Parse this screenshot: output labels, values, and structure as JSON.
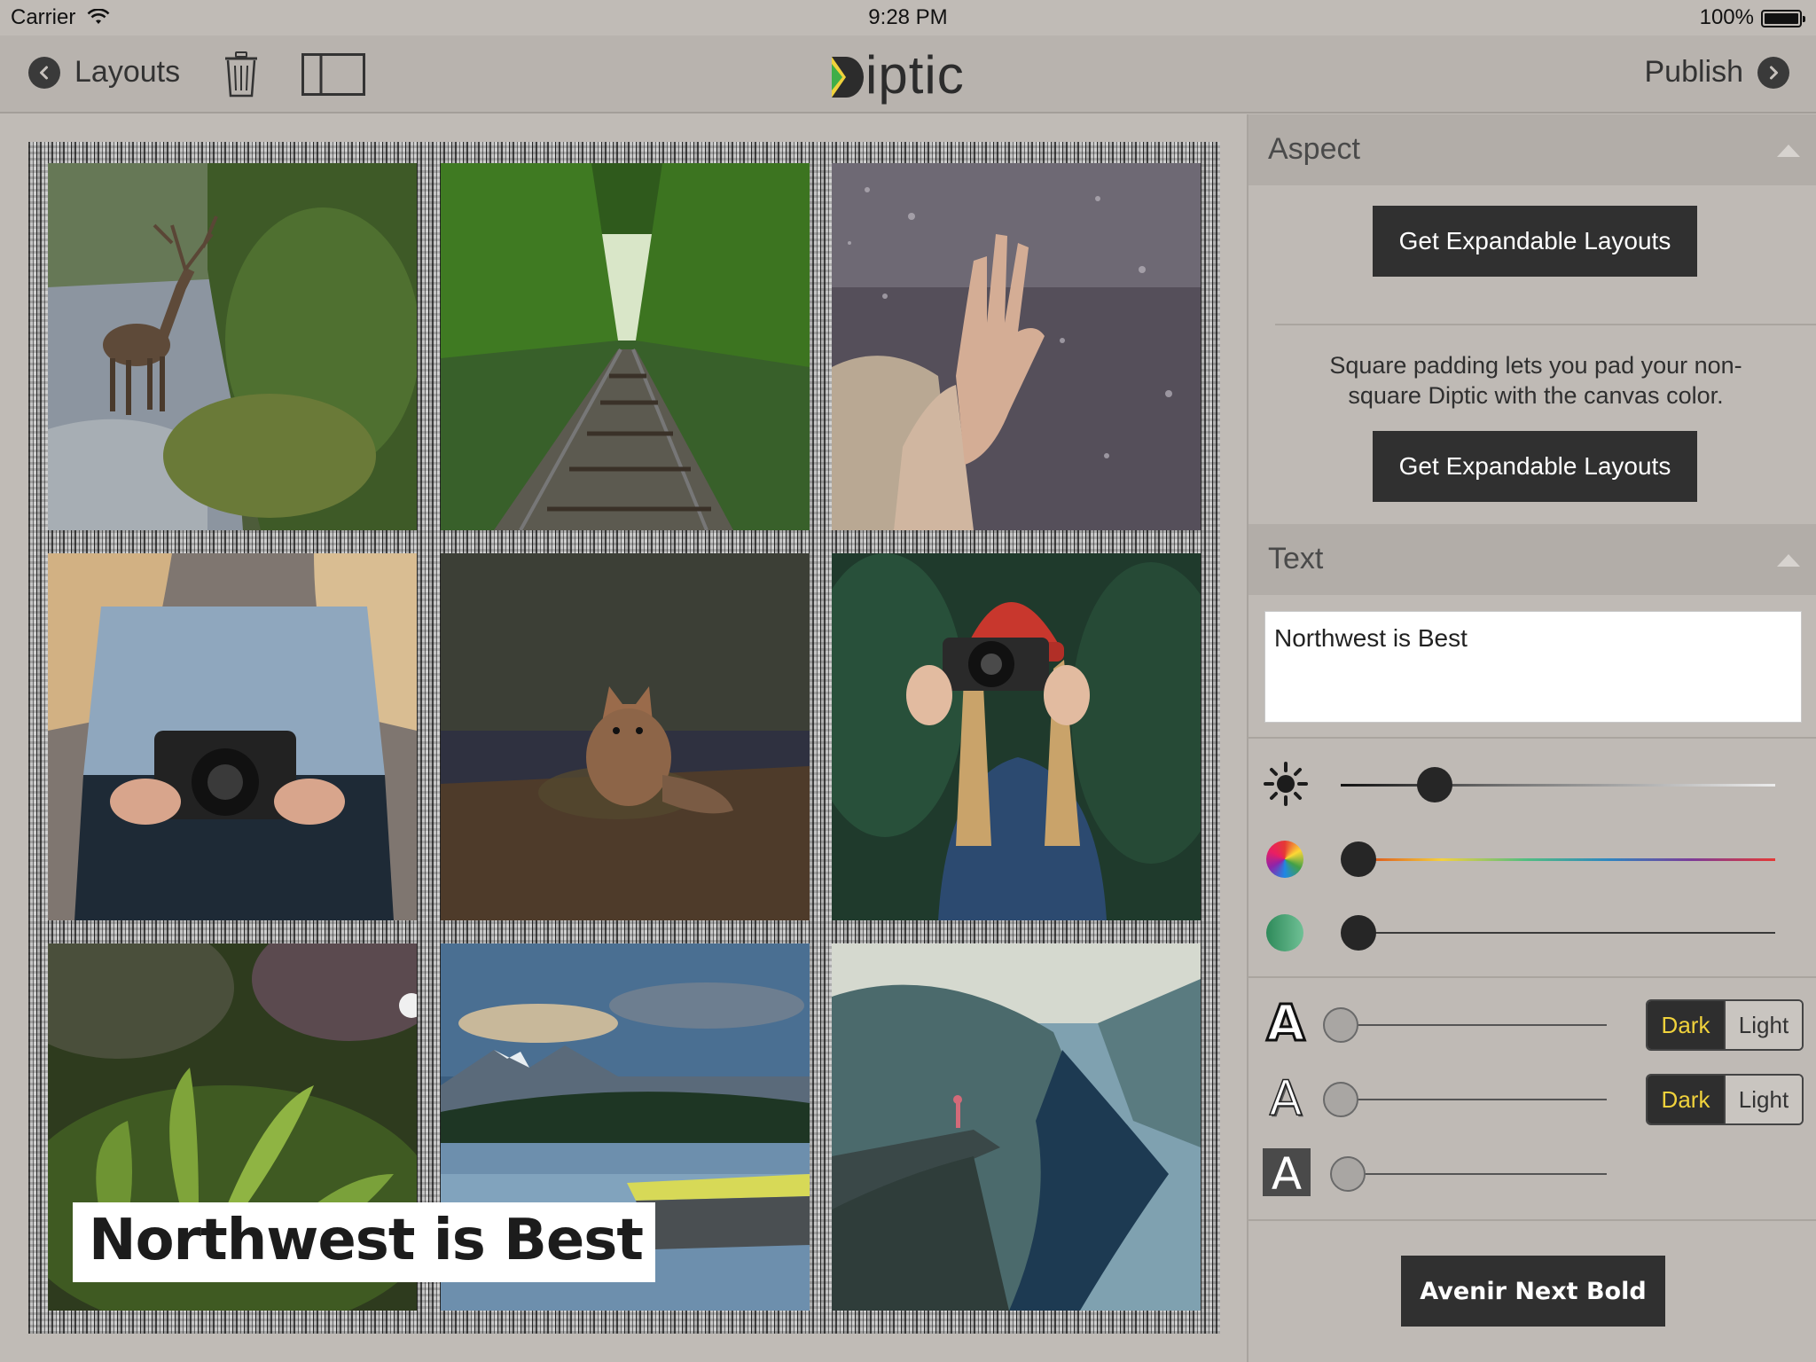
{
  "status": {
    "carrier": "Carrier",
    "time": "9:28 PM",
    "battery": "100%"
  },
  "nav": {
    "back_label": "Layouts",
    "brand": "iptic",
    "publish_label": "Publish"
  },
  "canvas": {
    "overlay_text": "Northwest is Best"
  },
  "photos": [
    "deer-in-stream",
    "railway-in-forest",
    "hand-behind-rainy-glass",
    "person-holding-camera",
    "fox-in-woods",
    "woman-red-beanie-camera",
    "fern-closeup",
    "mountain-lake-dock",
    "fjord-cliff-overlook"
  ],
  "sidebar": {
    "aspect": {
      "title": "Aspect",
      "button1": "Get Expandable Layouts",
      "description": "Square padding lets you pad your non-square Diptic with the canvas color.",
      "button2": "Get Expandable Layouts"
    },
    "text": {
      "title": "Text",
      "value": "Northwest is Best",
      "style1": {
        "dark": "Dark",
        "light": "Light",
        "selected": "Dark"
      },
      "style2": {
        "dark": "Dark",
        "light": "Light",
        "selected": "Dark"
      },
      "font_label": "Avenir Next Bold"
    }
  },
  "colors": {
    "accent_yellow": "#f0d23c",
    "dark": "#303030"
  }
}
